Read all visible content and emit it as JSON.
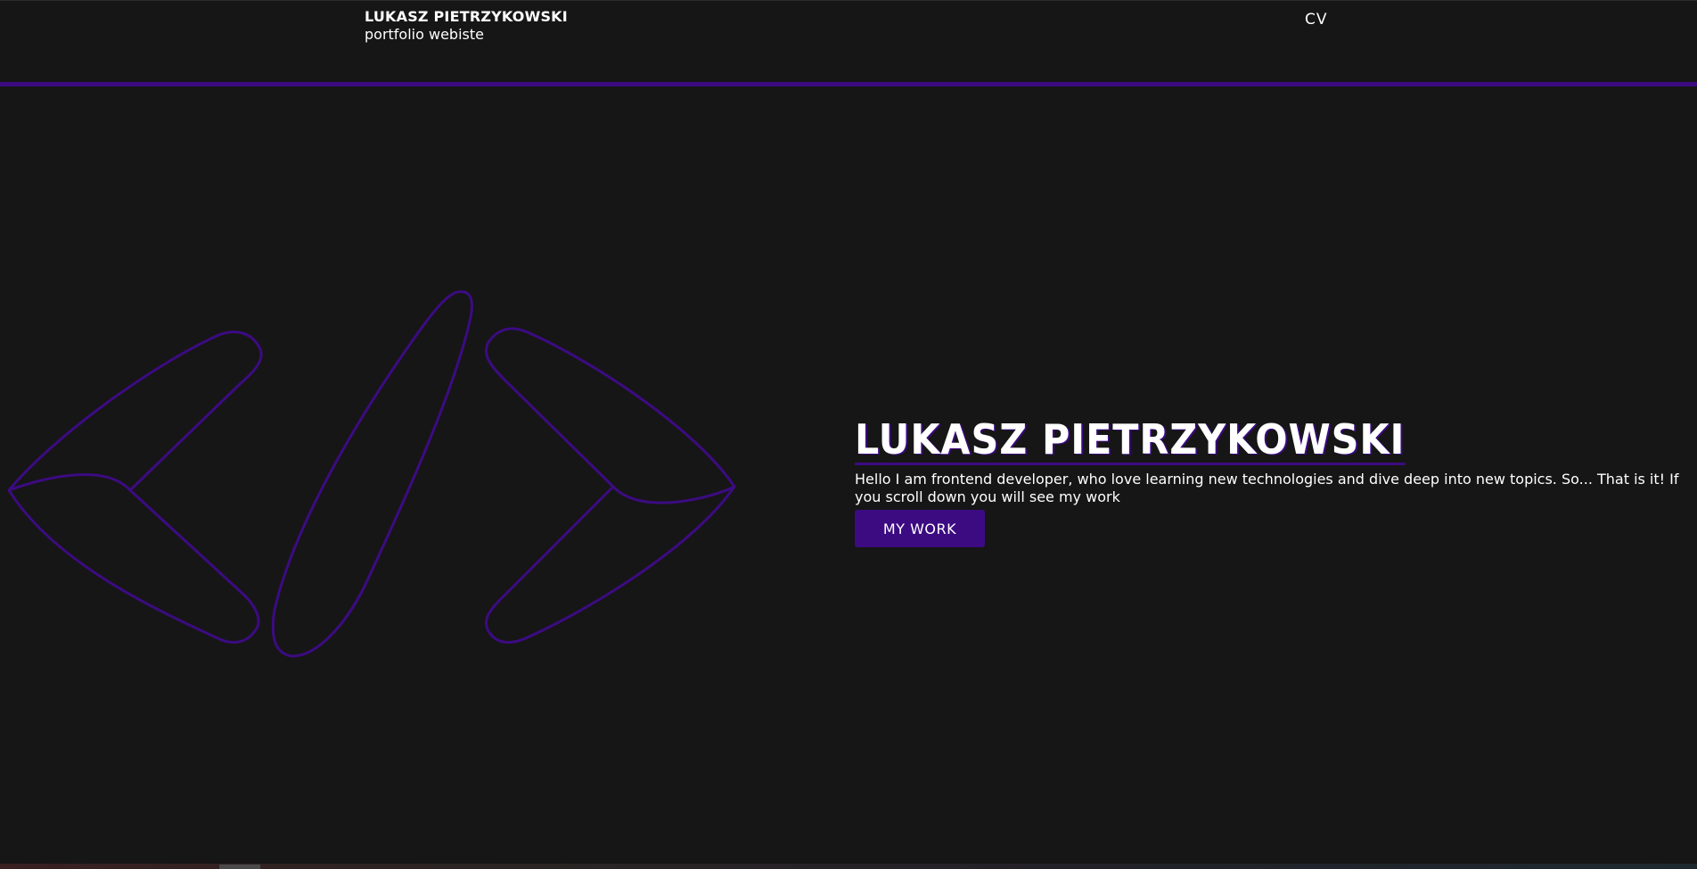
{
  "header": {
    "brand_name": "LUKASZ PIETRZYKOWSKI",
    "brand_subtitle": "portfolio webiste",
    "nav_cv": "CV"
  },
  "hero": {
    "title": "LUKASZ PIETRZYKOWSKI",
    "description": "Hello I am frontend developer, who love learning new technologies and dive deep into new topics. So... That is it! If you scroll down you will see my work",
    "button_label": "MY WORK"
  },
  "logo": {
    "icon": "code-brackets-icon"
  },
  "colors": {
    "background": "#161616",
    "accent": "#3c0b82",
    "text": "#ffffff"
  }
}
